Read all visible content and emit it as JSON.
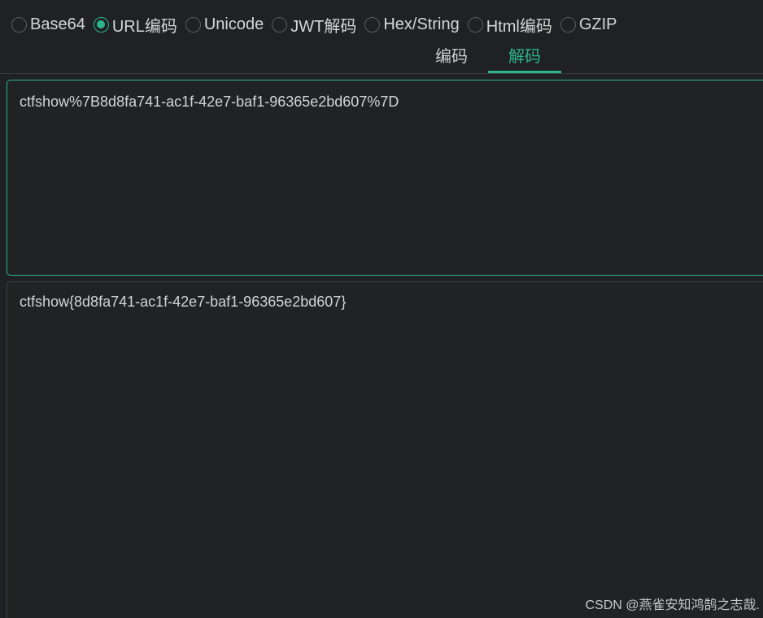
{
  "modes": [
    {
      "label": "Base64",
      "checked": false
    },
    {
      "label": "URL编码",
      "checked": true
    },
    {
      "label": "Unicode",
      "checked": false
    },
    {
      "label": "JWT解码",
      "checked": false
    },
    {
      "label": "Hex/String",
      "checked": false
    },
    {
      "label": "Html编码",
      "checked": false
    },
    {
      "label": "GZIP",
      "checked": false
    }
  ],
  "tabs": [
    {
      "label": "编码",
      "active": false
    },
    {
      "label": "解码",
      "active": true
    }
  ],
  "input_text": "ctfshow%7B8d8fa741-ac1f-42e7-baf1-96365e2bd607%7D",
  "output_text": "ctfshow{8d8fa741-ac1f-42e7-baf1-96365e2bd607}",
  "watermark": "CSDN @燕雀安知鸿鹄之志哉.",
  "colors": {
    "accent": "#2bb58e",
    "background": "#202124"
  }
}
